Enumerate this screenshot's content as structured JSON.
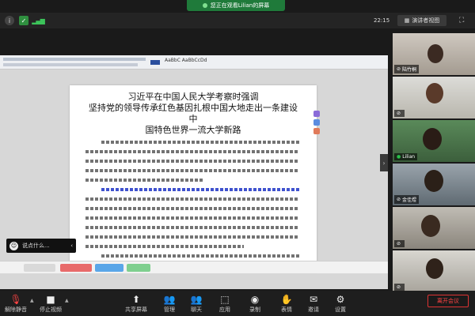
{
  "share_banner": {
    "text": "您正在观看Lilian的屏幕"
  },
  "topbar": {
    "clock": "22:15",
    "view_label": "演讲者视图"
  },
  "document": {
    "title_line1": "习近平在中国人民大学考察时强调",
    "title_line2": "坚持党的领导传承红色基因扎根中国大地走出一条建设中",
    "title_line3": "国特色世界一流大学新路"
  },
  "chat_toast": {
    "text": "说点什么..."
  },
  "participants": [
    {
      "name": "陆竹桐",
      "muted": true
    },
    {
      "name": "",
      "muted": true
    },
    {
      "name": "Lilian",
      "muted": false
    },
    {
      "name": "金佳煜",
      "muted": true
    },
    {
      "name": "",
      "muted": true
    },
    {
      "name": "",
      "muted": true
    }
  ],
  "toolbar": {
    "mute": "解除静音",
    "video": "停止视频",
    "share": "共享屏幕",
    "participants": "管理",
    "chat": "聊天",
    "record": "录制",
    "reactions": "表情",
    "apps": "应用",
    "settings": "设置",
    "invite": "邀请",
    "leave": "离开会议"
  },
  "colors": {
    "accent_green": "#1f7a3a",
    "leave_red": "#f44444",
    "doc_blue": "#2a3fc8"
  }
}
